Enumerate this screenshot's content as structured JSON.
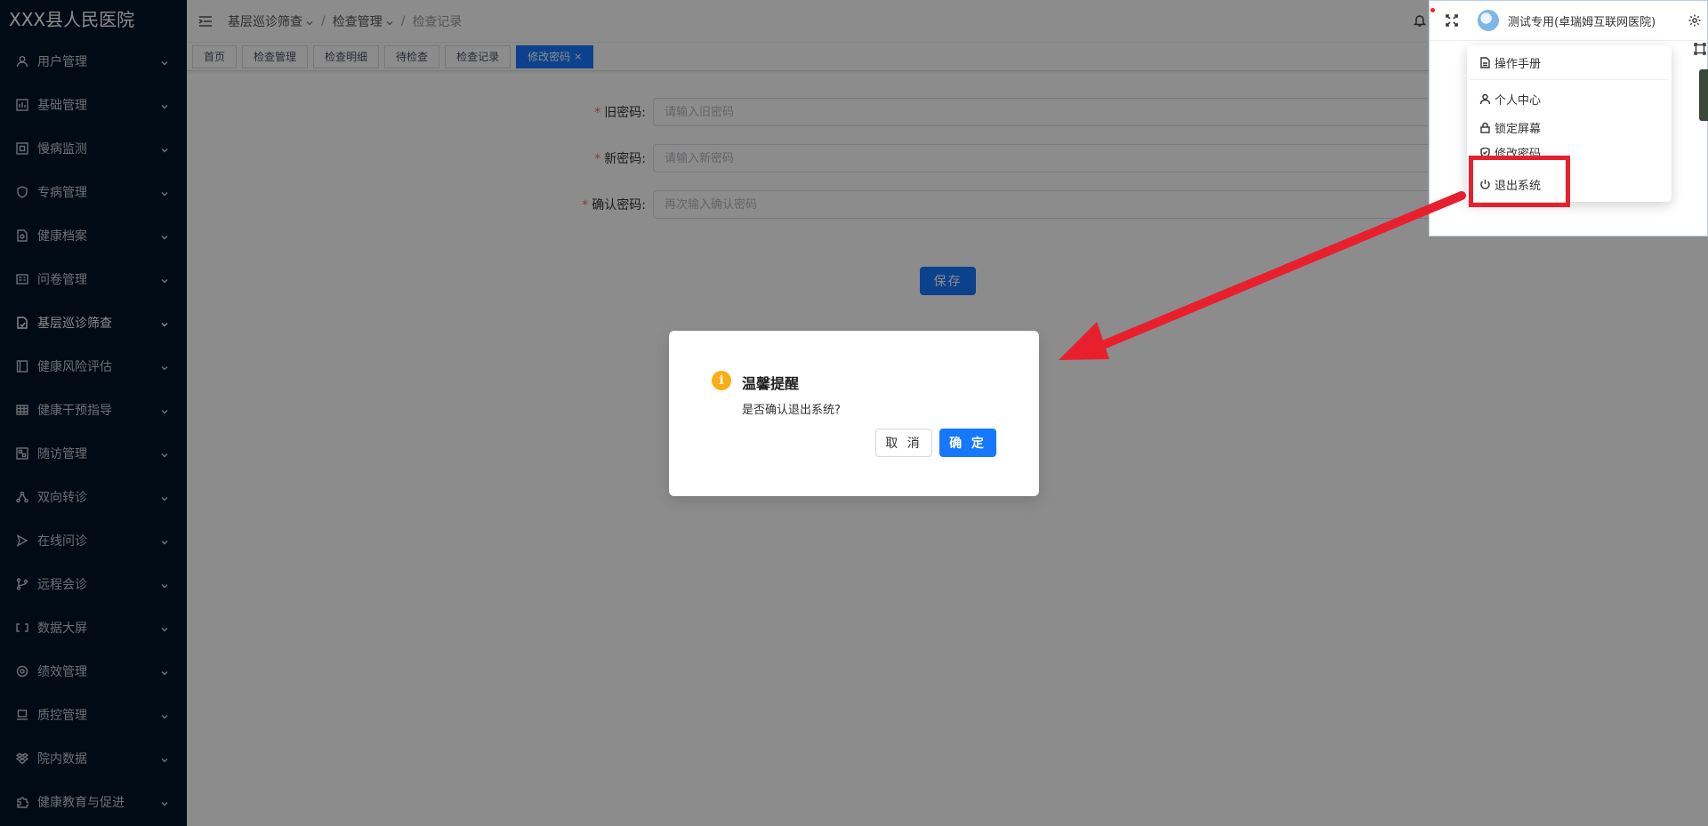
{
  "app": {
    "title": "XXX县人民医院"
  },
  "sidebar": {
    "items": [
      {
        "label": "用户管理",
        "icon": "user-icon"
      },
      {
        "label": "基础管理",
        "icon": "chart-box-icon"
      },
      {
        "label": "慢病监测",
        "icon": "monitor-square-icon"
      },
      {
        "label": "专病管理",
        "icon": "shield-icon"
      },
      {
        "label": "健康档案",
        "icon": "file-search-icon"
      },
      {
        "label": "问卷管理",
        "icon": "questionnaire-icon"
      },
      {
        "label": "基层巡诊筛查",
        "icon": "file-check-icon"
      },
      {
        "label": "健康风险评估",
        "icon": "book-icon"
      },
      {
        "label": "健康干预指导",
        "icon": "grid-icon"
      },
      {
        "label": "随访管理",
        "icon": "calendar-icon"
      },
      {
        "label": "双向转诊",
        "icon": "network-icon"
      },
      {
        "label": "在线问诊",
        "icon": "send-icon"
      },
      {
        "label": "远程会诊",
        "icon": "branch-icon"
      },
      {
        "label": "数据大屏",
        "icon": "screen-bracket-icon"
      },
      {
        "label": "绩效管理",
        "icon": "disc-icon"
      },
      {
        "label": "质控管理",
        "icon": "laptop-icon"
      },
      {
        "label": "院内数据",
        "icon": "dropbox-icon"
      },
      {
        "label": "健康教育与促进",
        "icon": "puzzle-icon"
      }
    ]
  },
  "header": {
    "breadcrumb": [
      "基层巡诊筛查",
      "检查管理",
      "检查记录"
    ]
  },
  "tabs": [
    {
      "label": "首页"
    },
    {
      "label": "检查管理"
    },
    {
      "label": "检查明细"
    },
    {
      "label": "待检查"
    },
    {
      "label": "检查记录"
    },
    {
      "label": "修改密码",
      "close": "×"
    }
  ],
  "form": {
    "old_password": {
      "label": "旧密码:",
      "placeholder": "请输入旧密码"
    },
    "new_password": {
      "label": "新密码:",
      "placeholder": "请输入新密码"
    },
    "confirm_password": {
      "label": "确认密码:",
      "placeholder": "再次输入确认密码"
    },
    "required_mark": "*",
    "save_label": "保存"
  },
  "user_menu": {
    "user_name": "测试专用(卓瑞姆互联网医院)",
    "items": [
      "操作手册",
      "个人中心",
      "锁定屏幕",
      "修改密码",
      "退出系统"
    ]
  },
  "dialog": {
    "icon_glyph": "i",
    "title": "温馨提醒",
    "message": "是否确认退出系统?",
    "cancel_label": "取 消",
    "ok_label": "确 定"
  },
  "colors": {
    "sidebar_bg": "#001529",
    "primary": "#1677ff",
    "warning": "#faad14",
    "annotation_red": "#e8202e"
  }
}
